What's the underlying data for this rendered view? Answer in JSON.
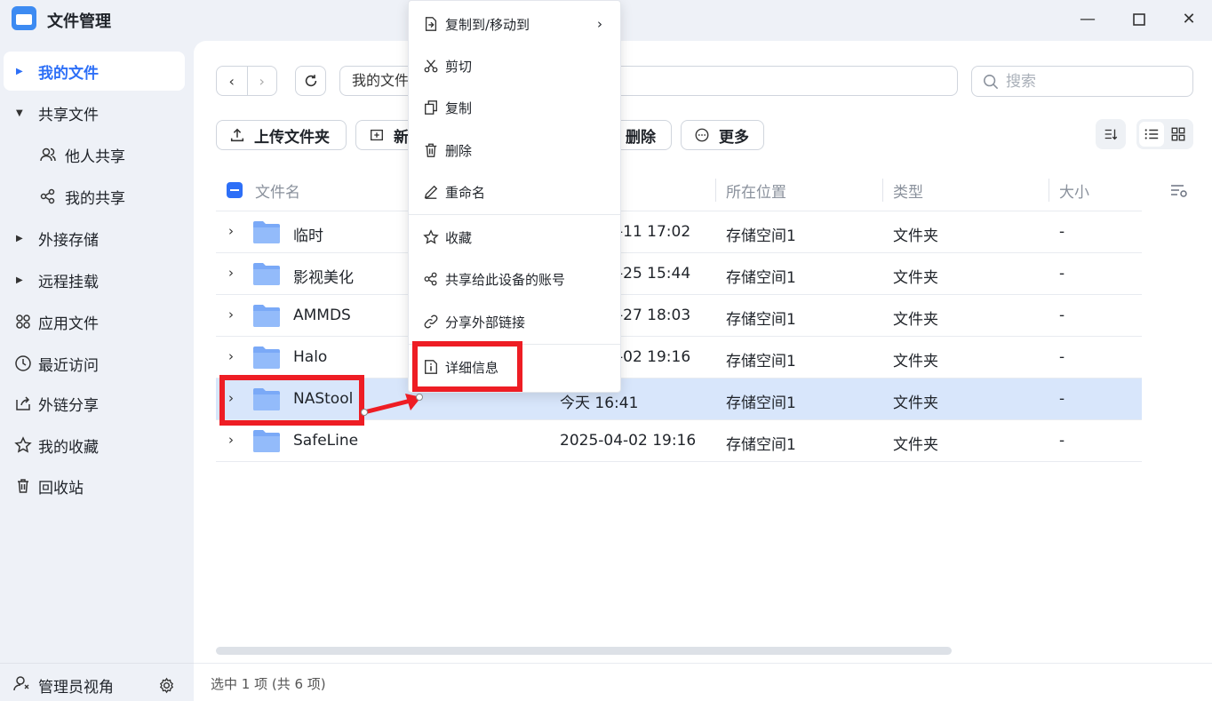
{
  "app": {
    "title": "文件管理"
  },
  "window_controls": {
    "minimize": "—",
    "maximize": "☐",
    "close": "✕"
  },
  "sidebar": {
    "items": [
      {
        "label": "我的文件",
        "icon": "caret-right-icon",
        "active": true
      },
      {
        "label": "共享文件",
        "icon": "caret-down-icon"
      },
      {
        "label": "他人共享",
        "icon": "users-icon"
      },
      {
        "label": "我的共享",
        "icon": "share-nodes-icon"
      },
      {
        "label": "外接存储",
        "icon": "caret-right-icon"
      },
      {
        "label": "远程挂载",
        "icon": "caret-right-icon"
      },
      {
        "label": "应用文件",
        "icon": "apps-grid-icon"
      },
      {
        "label": "最近访问",
        "icon": "clock-icon"
      },
      {
        "label": "外链分享",
        "icon": "external-share-icon"
      },
      {
        "label": "我的收藏",
        "icon": "star-icon"
      },
      {
        "label": "回收站",
        "icon": "trash-icon"
      }
    ],
    "footer": {
      "label": "管理员视角",
      "icon": "admin-user-icon",
      "settings_icon": "gear-icon"
    }
  },
  "toolbar": {
    "path": "我的文件",
    "search_placeholder": "搜索",
    "upload_folder": "上传文件夹",
    "new_label": "新",
    "delete_label": "删除",
    "more_label": "更多"
  },
  "table": {
    "headers": {
      "name": "文件名",
      "location": "所在位置",
      "type": "类型",
      "size": "大小"
    },
    "rows": [
      {
        "name": "临时",
        "modified": "-11 17:02",
        "location": "存储空间1",
        "type": "文件夹",
        "size": "-"
      },
      {
        "name": "影视美化",
        "modified": "-25 15:44",
        "location": "存储空间1",
        "type": "文件夹",
        "size": "-"
      },
      {
        "name": "AMMDS",
        "modified": "-27 18:03",
        "location": "存储空间1",
        "type": "文件夹",
        "size": "-"
      },
      {
        "name": "Halo",
        "modified": "-02 19:16",
        "location": "存储空间1",
        "type": "文件夹",
        "size": "-"
      },
      {
        "name": "NAStool",
        "modified": "今天 16:41",
        "location": "存储空间1",
        "type": "文件夹",
        "size": "-",
        "selected": true
      },
      {
        "name": "SafeLine",
        "modified": "2025-04-02 19:16",
        "location": "存储空间1",
        "type": "文件夹",
        "size": "-"
      }
    ]
  },
  "status": {
    "text": "选中 1 项 (共 6 项)"
  },
  "context_menu": {
    "items": [
      {
        "label": "复制到/移动到",
        "icon": "copy-move-icon",
        "has_submenu": true
      },
      {
        "label": "剪切",
        "icon": "scissors-icon"
      },
      {
        "label": "复制",
        "icon": "copy-icon"
      },
      {
        "label": "删除",
        "icon": "trash-icon"
      },
      {
        "label": "重命名",
        "icon": "pencil-icon"
      },
      {
        "label": "收藏",
        "icon": "star-icon"
      },
      {
        "label": "共享给此设备的账号",
        "icon": "share-nodes-icon"
      },
      {
        "label": "分享外部链接",
        "icon": "link-icon"
      },
      {
        "label": "详细信息",
        "icon": "info-icon"
      }
    ],
    "submenu_arrow": "›"
  },
  "colors": {
    "accent": "#2d6ff7",
    "highlight": "#ee1d24",
    "selected_row": "#d8e6fb",
    "folder": "#7aa9f7"
  }
}
